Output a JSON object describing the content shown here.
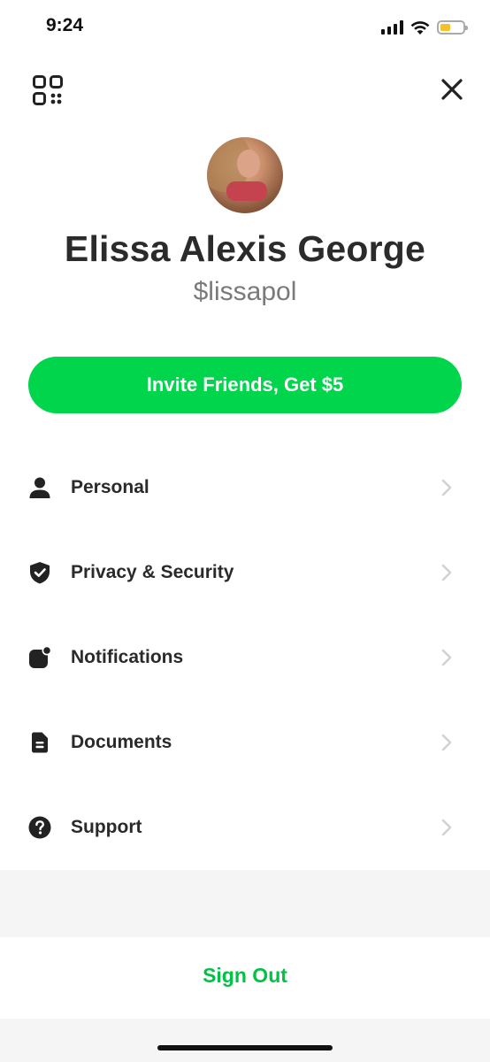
{
  "status_bar": {
    "time": "9:24",
    "battery_color": "#f4c12b"
  },
  "header": {
    "qr_icon": "qr-code-icon",
    "close_icon": "close-icon"
  },
  "profile": {
    "name": "Elissa Alexis George",
    "cashtag": "$lissapol"
  },
  "invite": {
    "label": "Invite Friends, Get $5",
    "color": "#00d54b"
  },
  "menu": {
    "items": [
      {
        "label": "Personal",
        "icon": "person-icon"
      },
      {
        "label": "Privacy & Security",
        "icon": "shield-check-icon"
      },
      {
        "label": "Notifications",
        "icon": "notification-icon"
      },
      {
        "label": "Documents",
        "icon": "document-icon"
      },
      {
        "label": "Support",
        "icon": "help-icon"
      }
    ]
  },
  "footer": {
    "sign_out_label": "Sign Out",
    "sign_out_color": "#00c244"
  }
}
